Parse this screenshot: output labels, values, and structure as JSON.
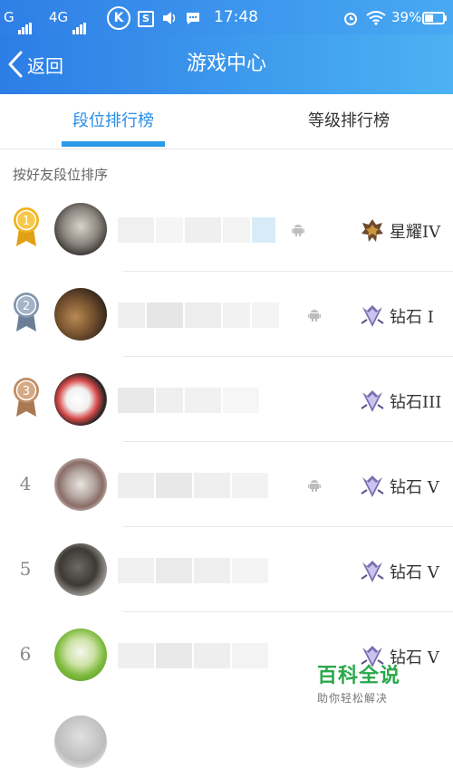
{
  "status_bar": {
    "carrier1": "G",
    "carrier2": "4G",
    "k_badge": "K",
    "s_badge": "S",
    "time": "17:48",
    "battery": "39%"
  },
  "header": {
    "back_label": "返回",
    "title": "游戏中心"
  },
  "tabs": [
    {
      "label": "段位排行榜",
      "active": true
    },
    {
      "label": "等级排行榜",
      "active": false
    }
  ],
  "section_label": "按好友段位排序",
  "rows": [
    {
      "rank": "1",
      "medal": "gold-medal-icon",
      "tier": "星耀IV",
      "tier_icon": "star-glory-icon"
    },
    {
      "rank": "2",
      "medal": "silver-medal-icon",
      "tier": "钻石 I",
      "tier_icon": "diamond-icon"
    },
    {
      "rank": "3",
      "medal": "bronze-medal-icon",
      "tier": "钻石III",
      "tier_icon": "diamond-icon"
    },
    {
      "rank": "4",
      "medal": null,
      "tier": "钻石 V",
      "tier_icon": "diamond-icon"
    },
    {
      "rank": "5",
      "medal": null,
      "tier": "钻石 V",
      "tier_icon": "diamond-icon"
    },
    {
      "rank": "6",
      "medal": null,
      "tier": "钻石 V",
      "tier_icon": "diamond-icon"
    }
  ],
  "watermark": {
    "title": "百科全说",
    "subtitle": "助你轻松解决"
  },
  "colors": {
    "header_gradient_start": "#2c7de5",
    "header_gradient_end": "#4cb2f3",
    "tab_active": "#2a8ee6",
    "watermark_green": "#2aa84a"
  }
}
